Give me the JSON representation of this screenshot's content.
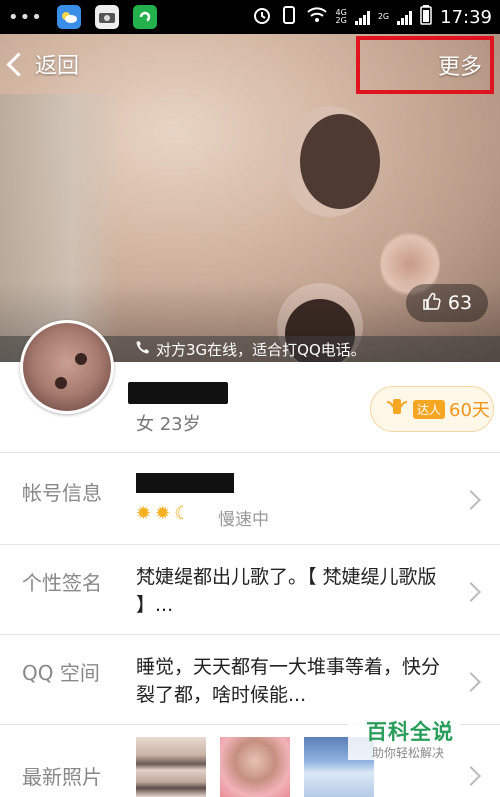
{
  "status_bar": {
    "time": "17:39",
    "network_labels": [
      "4G",
      "2G",
      "2G"
    ]
  },
  "nav": {
    "back_label": "返回",
    "more_label": "更多"
  },
  "cover": {
    "like_count": "63",
    "online_text": "对方3G在线，适合打QQ电话。"
  },
  "profile": {
    "gender_age": "女 23岁",
    "talent_tag": "达人",
    "talent_days": "60天"
  },
  "rows": {
    "account": {
      "label": "帐号信息",
      "speed": "慢速中"
    },
    "signature": {
      "label": "个性签名",
      "text": "梵婕缇都出儿歌了。【 梵婕缇儿歌版 】..."
    },
    "qzone": {
      "label": "QQ 空间",
      "text": "睡觉，天天都有一大堆事等着，快分裂了都，啥时候能..."
    },
    "photos": {
      "label": "最新照片"
    }
  },
  "watermark": {
    "title": "百科全说",
    "subtitle": "助你轻松解决"
  },
  "colors": {
    "highlight_border": "#e0141e",
    "talent_orange": "#f0951a",
    "watermark_green": "#2a9d5b"
  }
}
